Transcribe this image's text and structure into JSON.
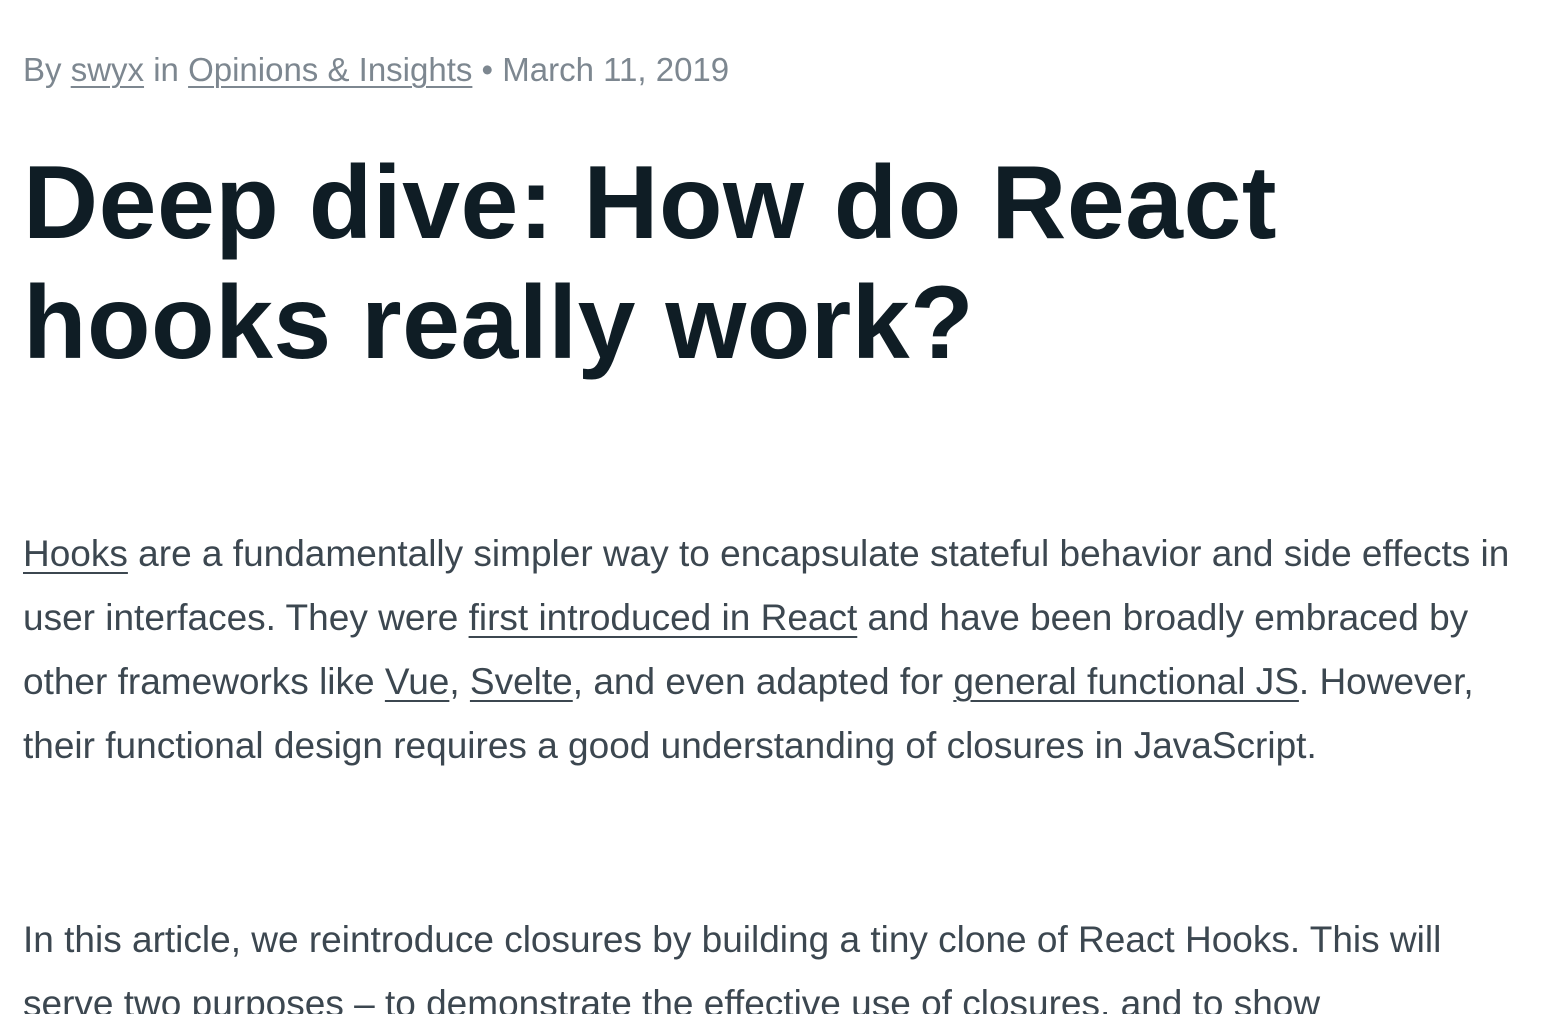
{
  "byline": {
    "by": "By ",
    "author": "swyx",
    "in": " in ",
    "category": "Opinions & Insights",
    "separator": " • ",
    "date": "March 11, 2019"
  },
  "title": "Deep dive: How do React hooks really work?",
  "paragraph1": {
    "link_hooks": "Hooks",
    "t1": " are a fundamentally simpler way to encapsulate stateful behavior and side effects in user interfaces. They were ",
    "link_react": "first introduced in React",
    "t2": " and have been broadly embraced by other frameworks like ",
    "link_vue": "Vue",
    "t3": ", ",
    "link_svelte": "Svelte",
    "t4": ", and even adapted for ",
    "link_general": "general functional JS",
    "t5": ". However, their functional design requires a good understanding of closures in JavaScript."
  },
  "paragraph2": {
    "text": "In this article, we reintroduce closures by building a tiny clone of React Hooks. This will serve two purposes – to demonstrate the effective use of closures, and to show"
  }
}
